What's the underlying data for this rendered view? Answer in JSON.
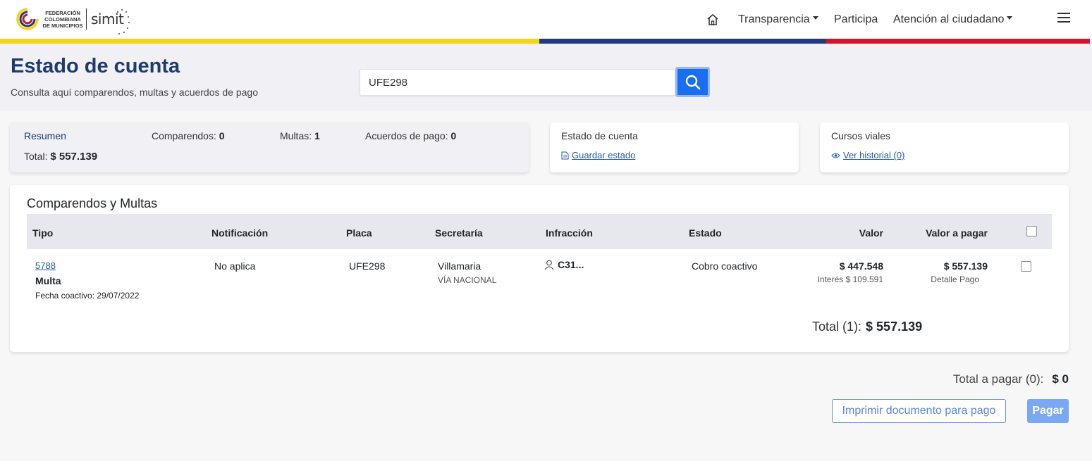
{
  "header": {
    "logo_fed_line1": "FEDERACIÓN",
    "logo_fed_line2": "COLOMBIANA",
    "logo_fed_line3": "DE MUNICIPIOS",
    "logo_simit": "simit",
    "nav": {
      "home_icon": "home-icon",
      "transparencia": "Transparencia",
      "participa": "Participa",
      "atencion": "Atención al ciudadano"
    },
    "menu_icon": "hamburger-icon",
    "stripe_colors": [
      "#f5d418",
      "#1f3b7a",
      "#d0142c"
    ]
  },
  "hero": {
    "title": "Estado de cuenta",
    "subtitle": "Consulta aquí comparendos, multas y acuerdos de pago",
    "search_value": "UFE298",
    "search_icon": "search-icon"
  },
  "summary": {
    "resumen_label": "Resumen",
    "comparendos_label": "Comparendos:",
    "comparendos_value": "0",
    "multas_label": "Multas:",
    "multas_value": "1",
    "acuerdos_label": "Acuerdos de pago:",
    "acuerdos_value": "0",
    "total_label": "Total:",
    "total_value": "$ 557.139"
  },
  "estado_card": {
    "title": "Estado de cuenta",
    "link": "Guardar estado",
    "icon": "document-icon"
  },
  "cursos_card": {
    "title": "Cursos viales",
    "link": "Ver historial (0)",
    "icon": "eye-icon"
  },
  "table": {
    "title": "Comparendos y Multas",
    "headers": {
      "tipo": "Tipo",
      "notificacion": "Notificación",
      "placa": "Placa",
      "secretaria": "Secretaría",
      "infraccion": "Infracción",
      "estado": "Estado",
      "valor": "Valor",
      "valor_pagar": "Valor a pagar"
    },
    "rows": [
      {
        "numero": "5788",
        "tipo": "Multa",
        "fecha": "Fecha coactivo: 29/07/2022",
        "notificacion": "No aplica",
        "placa": "UFE298",
        "secretaria": "Villamaria",
        "secretaria_sub": "VÍA NACIONAL",
        "infraccion": "C31...",
        "estado": "Cobro coactivo",
        "valor": "$ 447.548",
        "interes": "Interés $ 109.591",
        "valor_pagar": "$ 557.139",
        "detalle": "Detalle Pago"
      }
    ],
    "total_label": "Total (1):",
    "total_value": "$ 557.139"
  },
  "footer": {
    "total_pagar_label": "Total a pagar (0):",
    "total_pagar_value": "$ 0",
    "print_button": "Imprimir documento para pago",
    "pay_button": "Pagar"
  }
}
